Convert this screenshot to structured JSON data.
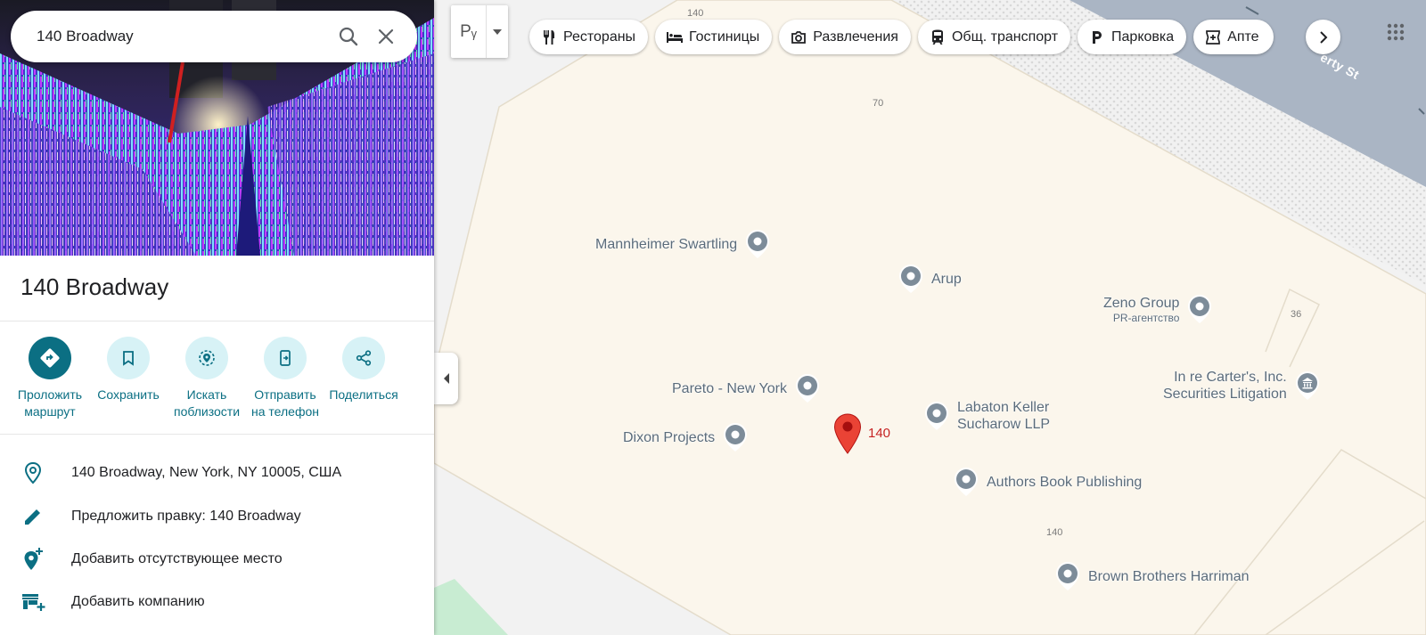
{
  "search": {
    "value": "140 Broadway",
    "search_icon": "search-icon",
    "clear_icon": "close-icon"
  },
  "place": {
    "title": "140 Broadway"
  },
  "actions": [
    {
      "label": "Проложить\nмаршрут",
      "icon": "directions-icon"
    },
    {
      "label": "Сохранить",
      "icon": "bookmark-icon"
    },
    {
      "label": "Искать\nпоблизости",
      "icon": "nearby-icon"
    },
    {
      "label": "Отправить\nна телефон",
      "icon": "send-to-phone-icon"
    },
    {
      "label": "Поделиться",
      "icon": "share-icon"
    }
  ],
  "info": [
    {
      "text": "140 Broadway, New York, NY 10005, США",
      "icon": "location-pin-icon"
    },
    {
      "text": "Предложить правку: 140 Broadway",
      "icon": "pencil-icon"
    },
    {
      "text": "Добавить отсутствующее место",
      "icon": "add-place-icon"
    },
    {
      "text": "Добавить компанию",
      "icon": "add-business-icon"
    }
  ],
  "layers": {
    "label": "Pᵧ"
  },
  "chips": [
    {
      "label": "Рестораны",
      "icon": "restaurant-icon"
    },
    {
      "label": "Гостиницы",
      "icon": "hotel-icon"
    },
    {
      "label": "Развлечения",
      "icon": "camera-icon"
    },
    {
      "label": "Общ. транспорт",
      "icon": "transit-icon"
    },
    {
      "label": "Парковка",
      "icon": "parking-icon"
    },
    {
      "label": "Апте",
      "icon": "pharmacy-icon"
    }
  ],
  "map": {
    "street_numbers": [
      "140",
      "70",
      "36",
      "140"
    ],
    "street_name": "erty St",
    "main_pin_label": "140",
    "pois": [
      {
        "name": "Mannheimer Swartling",
        "sub": ""
      },
      {
        "name": "Arup",
        "sub": ""
      },
      {
        "name": "Zeno Group",
        "sub": "PR-агентство"
      },
      {
        "name": "Pareto - New York",
        "sub": ""
      },
      {
        "name": "In re Carter's, Inc.",
        "name2": "Securities Litigation",
        "sub": ""
      },
      {
        "name": "Labaton Keller",
        "name2": "Sucharow LLP",
        "sub": ""
      },
      {
        "name": "Dixon Projects",
        "sub": ""
      },
      {
        "name": "Authors Book Publishing",
        "sub": ""
      },
      {
        "name": "Brown Brothers Harriman",
        "sub": ""
      }
    ]
  },
  "colors": {
    "accent": "#0b6f83",
    "pin_red": "#ea4335",
    "water": "#aab5c4",
    "building": "#fbf6ec"
  }
}
